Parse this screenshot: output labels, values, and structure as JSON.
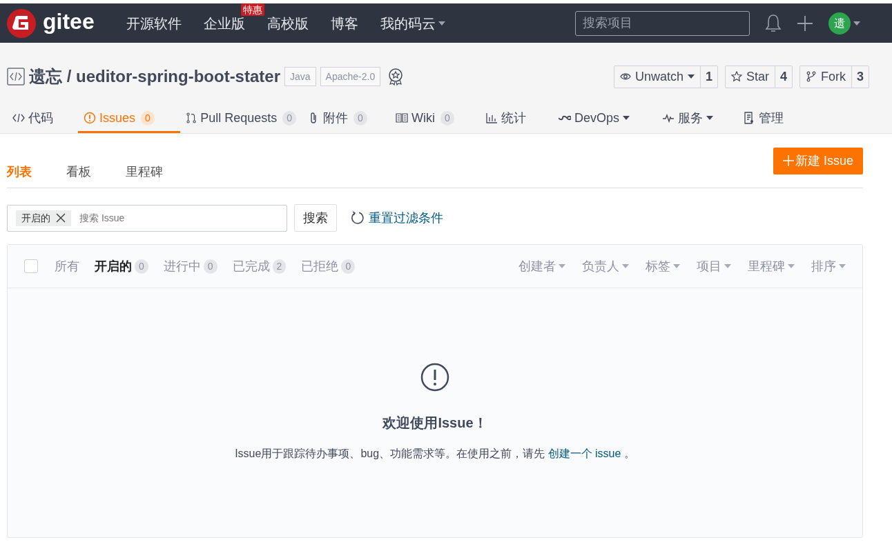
{
  "navbar": {
    "logo_text": "gitee",
    "links": [
      {
        "label": "开源软件",
        "dropdown": false
      },
      {
        "label": "企业版",
        "badge": "特惠",
        "dropdown": false
      },
      {
        "label": "高校版",
        "dropdown": false
      },
      {
        "label": "博客",
        "dropdown": false
      },
      {
        "label": "我的码云",
        "dropdown": true
      }
    ],
    "search": {
      "placeholder": "搜索项目"
    },
    "avatar": "遗"
  },
  "repo": {
    "title": "遗忘 / ueditor-spring-boot-stater",
    "tags": [
      "Java",
      "Apache-2.0"
    ],
    "actions": [
      {
        "kind": "watch",
        "label": "Unwatch",
        "count": "1",
        "dropdown": true
      },
      {
        "kind": "star",
        "label": "Star",
        "count": "4",
        "dropdown": false
      },
      {
        "kind": "fork",
        "label": "Fork",
        "count": "3",
        "dropdown": false
      }
    ]
  },
  "tabs": [
    {
      "kind": "code",
      "label": "代码",
      "dropdown": false,
      "selected": false
    },
    {
      "kind": "issues",
      "label": "Issues",
      "count": "0",
      "dropdown": false,
      "selected": true
    },
    {
      "kind": "pr",
      "label": "Pull Requests",
      "count": "0",
      "dropdown": false,
      "selected": false
    },
    {
      "kind": "attach",
      "label": "附件",
      "count": "0",
      "dropdown": false,
      "selected": false
    },
    {
      "kind": "wiki",
      "label": "Wiki",
      "count": "0",
      "dropdown": false,
      "selected": false
    },
    {
      "kind": "stats",
      "label": "统计",
      "dropdown": false,
      "selected": false
    },
    {
      "kind": "devops",
      "label": "DevOps",
      "dropdown": true,
      "selected": false
    },
    {
      "kind": "service",
      "label": "服务",
      "dropdown": true,
      "selected": false
    },
    {
      "kind": "admin",
      "label": "管理",
      "dropdown": false,
      "selected": false
    }
  ],
  "subtabs": [
    {
      "label": "列表",
      "selected": true
    },
    {
      "label": "看板",
      "selected": false
    },
    {
      "label": "里程碑",
      "selected": false
    }
  ],
  "new_issue_button": "新建 Issue",
  "filter": {
    "chip": "开启的",
    "placeholder": "搜索 Issue",
    "search_button": "搜索",
    "reset_link": "重置过滤条件"
  },
  "issue_list": {
    "select_all_checked": false,
    "states": [
      {
        "label": "所有",
        "selected": false
      },
      {
        "label": "开启的",
        "count": "0",
        "selected": true
      },
      {
        "label": "进行中",
        "count": "0",
        "selected": false
      },
      {
        "label": "已完成",
        "count": "2",
        "selected": false
      },
      {
        "label": "已拒绝",
        "count": "0",
        "selected": false
      }
    ],
    "filters": [
      "创建者",
      "负责人",
      "标签",
      "项目",
      "里程碑",
      "排序"
    ],
    "empty": {
      "title": "欢迎使用Issue！",
      "text": "Issue用于跟踪待办事项、bug、功能需求等。在使用之前，请先 ",
      "link": "创建一个 issue",
      "after": " 。"
    }
  }
}
